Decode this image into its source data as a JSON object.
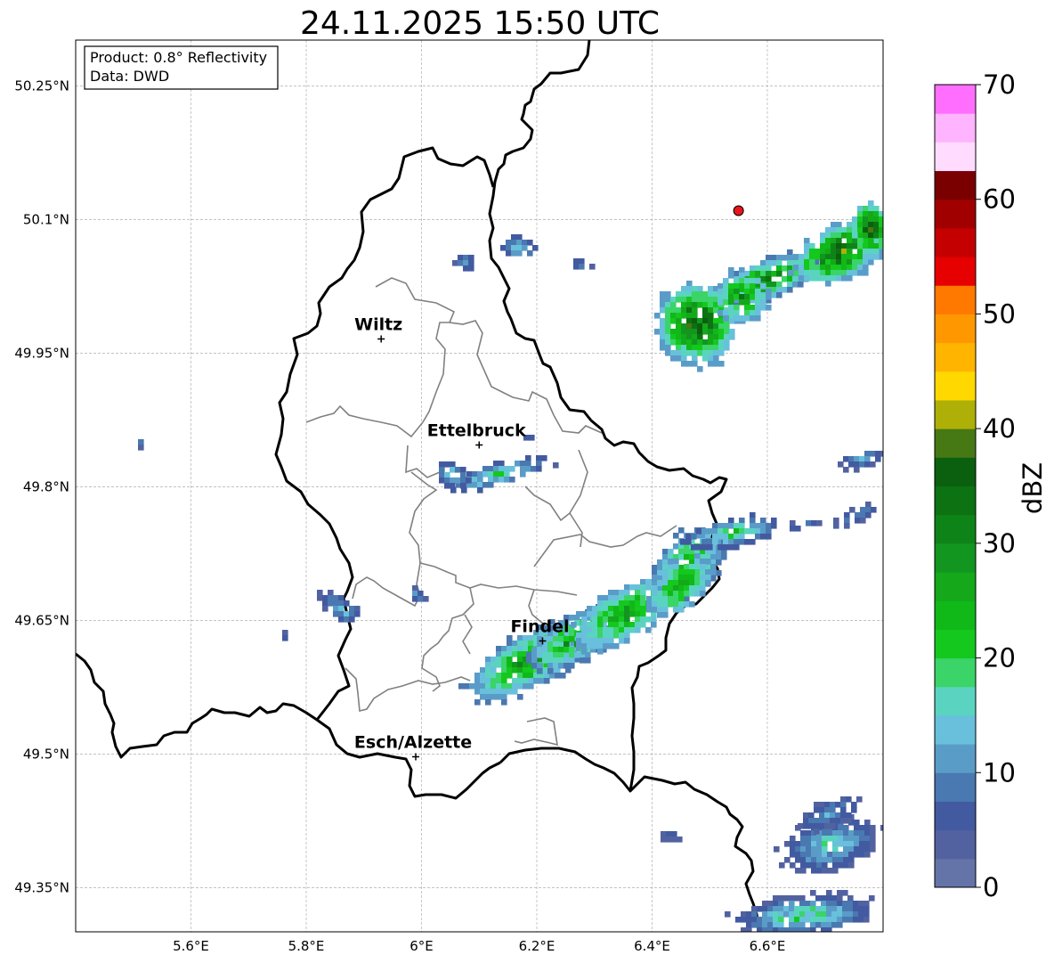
{
  "title": "24.11.2025 15:50 UTC",
  "info_box": {
    "product": "Product: 0.8° Reflectivity",
    "source": "Data: DWD"
  },
  "lat_ticks": [
    "50.25°N",
    "50.1°N",
    "49.95°N",
    "49.8°N",
    "49.65°N",
    "49.5°N",
    "49.35°N"
  ],
  "lon_ticks": [
    "5.6°E",
    "5.8°E",
    "6°E",
    "6.2°E",
    "6.4°E",
    "6.6°E"
  ],
  "cities": [
    {
      "name": "Wiltz",
      "lon": 5.93,
      "lat": 49.966
    },
    {
      "name": "Ettelbruck",
      "lon": 6.1,
      "lat": 49.847
    },
    {
      "name": "Findel",
      "lon": 6.21,
      "lat": 49.627
    },
    {
      "name": "Esch/Alzette",
      "lon": 5.99,
      "lat": 49.497
    }
  ],
  "radar_site_marker": {
    "lon": 6.55,
    "lat": 50.11,
    "color": "#e8141e"
  },
  "colorbar": {
    "label": "dBZ",
    "ticks": [
      "70",
      "60",
      "50",
      "40",
      "30",
      "20",
      "10",
      "0"
    ],
    "range": [
      0,
      70
    ],
    "step": 2.5,
    "colors": [
      "#6474a8",
      "#5262a0",
      "#425aa0",
      "#4a78b0",
      "#5a9cc8",
      "#68c0dc",
      "#5ad4c0",
      "#3ad468",
      "#14c81e",
      "#10b818",
      "#14a81a",
      "#129620",
      "#0e8418",
      "#0c7212",
      "#0a600e",
      "#467814",
      "#aeb008",
      "#ffd800",
      "#ffb400",
      "#ff9800",
      "#ff7800",
      "#e60000",
      "#c40000",
      "#a00000",
      "#7a0000",
      "#ffdcff",
      "#ffb4ff",
      "#ff6eff",
      "#e62ee6"
    ]
  },
  "colors": {
    "border_country": "#000000",
    "border_canton": "#808080",
    "grid": "#b0b0b0"
  }
}
